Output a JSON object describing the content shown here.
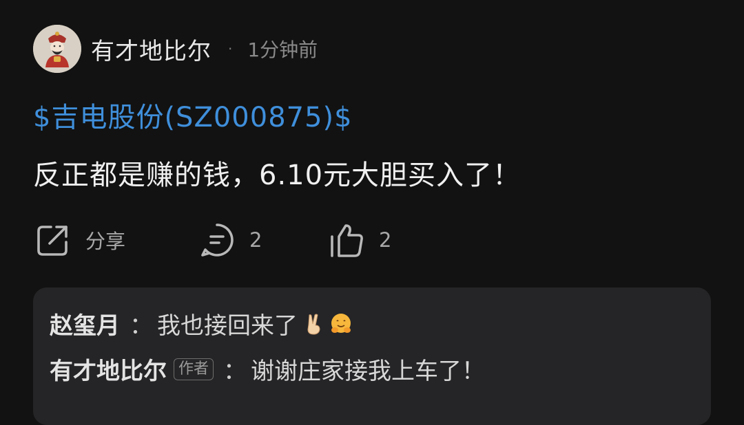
{
  "post": {
    "author": "有才地比尔",
    "time": "1分钟前",
    "separator": "·",
    "stock_link": "$吉电股份(SZ000875)$",
    "content": "反正都是赚的钱，6.10元大胆买入了！"
  },
  "actions": {
    "share_label": "分享",
    "comment_count": "2",
    "like_count": "2"
  },
  "comments": [
    {
      "author": "赵玺月",
      "separator": "：",
      "text": "我也接回来了",
      "emojis": [
        "victory-hand-emoji",
        "hugging-face-emoji"
      ]
    },
    {
      "author": "有才地比尔",
      "badge": "作者",
      "separator": "：",
      "text": "谢谢庄家接我上车了！"
    }
  ],
  "colors": {
    "background": "#121212",
    "link": "#3f8fdb",
    "comment_box": "#252527"
  }
}
